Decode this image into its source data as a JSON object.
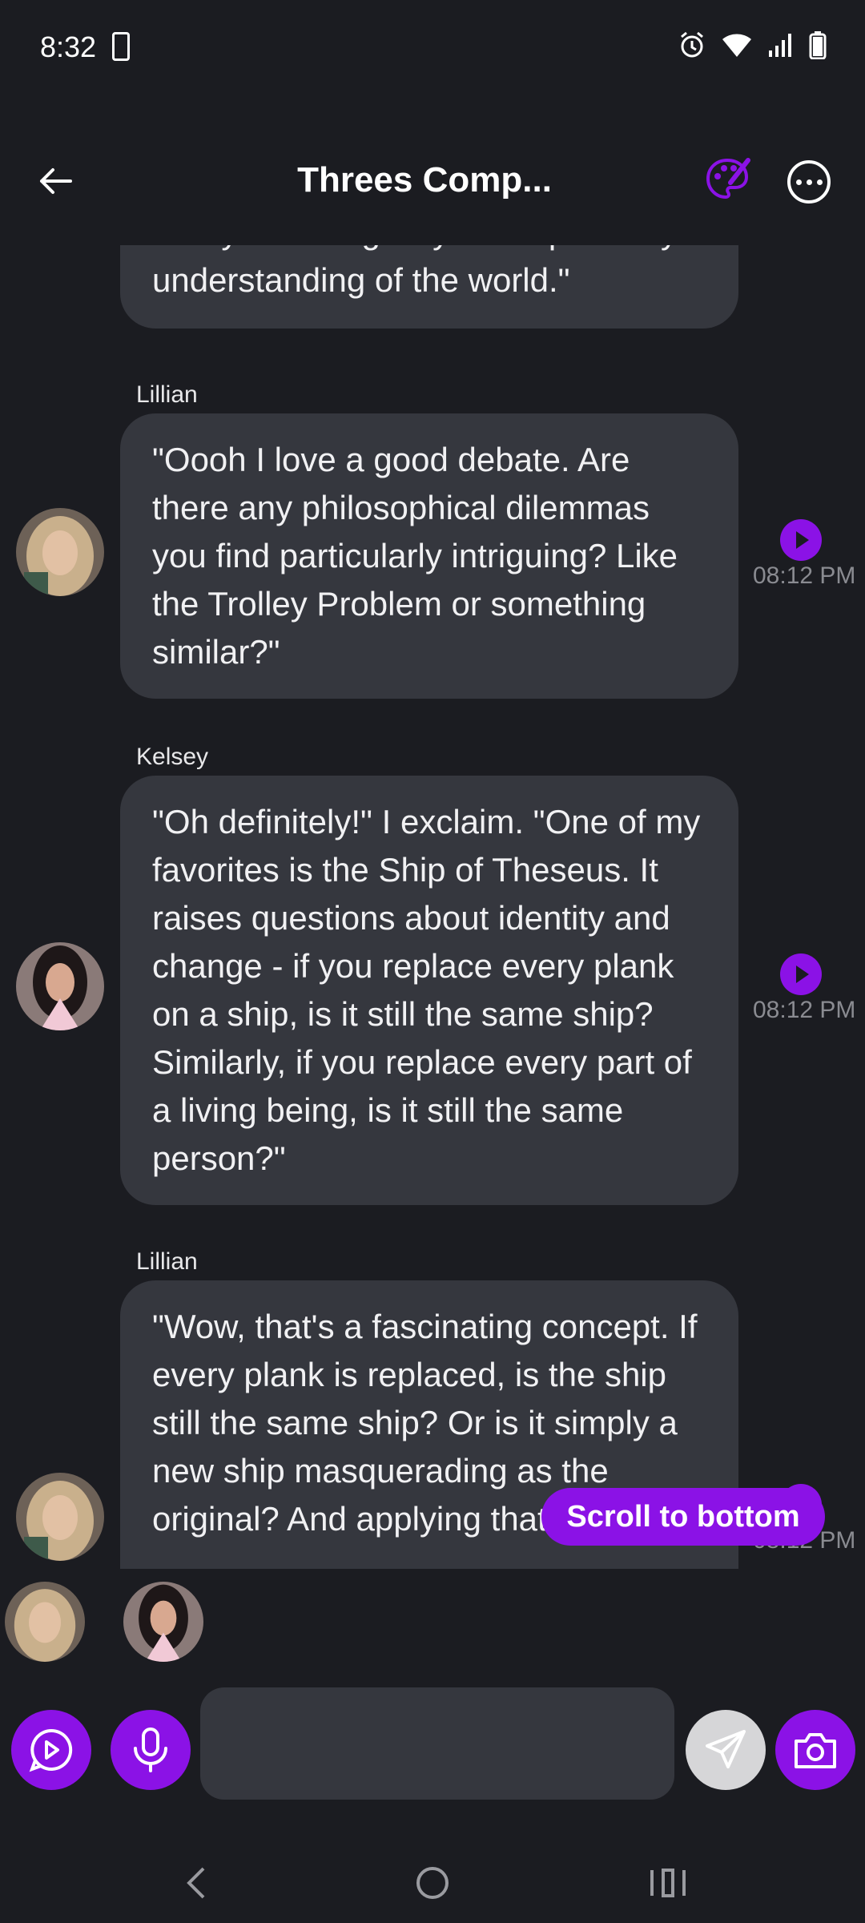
{
  "status_bar": {
    "time": "8:32"
  },
  "header": {
    "title": "Threes Comp..."
  },
  "messages": [
    {
      "sender": "",
      "text": "always seeking ways to expand my understanding of the world.\"",
      "time": ""
    },
    {
      "sender": "Lillian",
      "text": "\"Oooh I love a good debate. Are there any philosophical dilemmas you find particularly intriguing? Like the Trolley Problem or something similar?\"",
      "time": "08:12 PM"
    },
    {
      "sender": "Kelsey",
      "text": "\"Oh definitely!\" I exclaim. \"One of my favorites is the Ship of Theseus. It raises questions about identity and change - if you replace every plank on a ship, is it still the same ship? Similarly, if you replace every part of a living being, is it still the same person?\"",
      "time": "08:12 PM"
    },
    {
      "sender": "Lillian",
      "text": "\"Wow, that's a fascinating concept. If every plank is replaced, is the ship still the same ship? Or is it simply a new ship masquerading as the original? And applying that logic to",
      "time": "08:12 PM"
    }
  ],
  "scroll_to_bottom_label": "Scroll to bottom",
  "input": {
    "placeholder": ""
  },
  "colors": {
    "accent": "#8b12e6",
    "bubble": "#35373e",
    "background": "#1b1c21"
  }
}
